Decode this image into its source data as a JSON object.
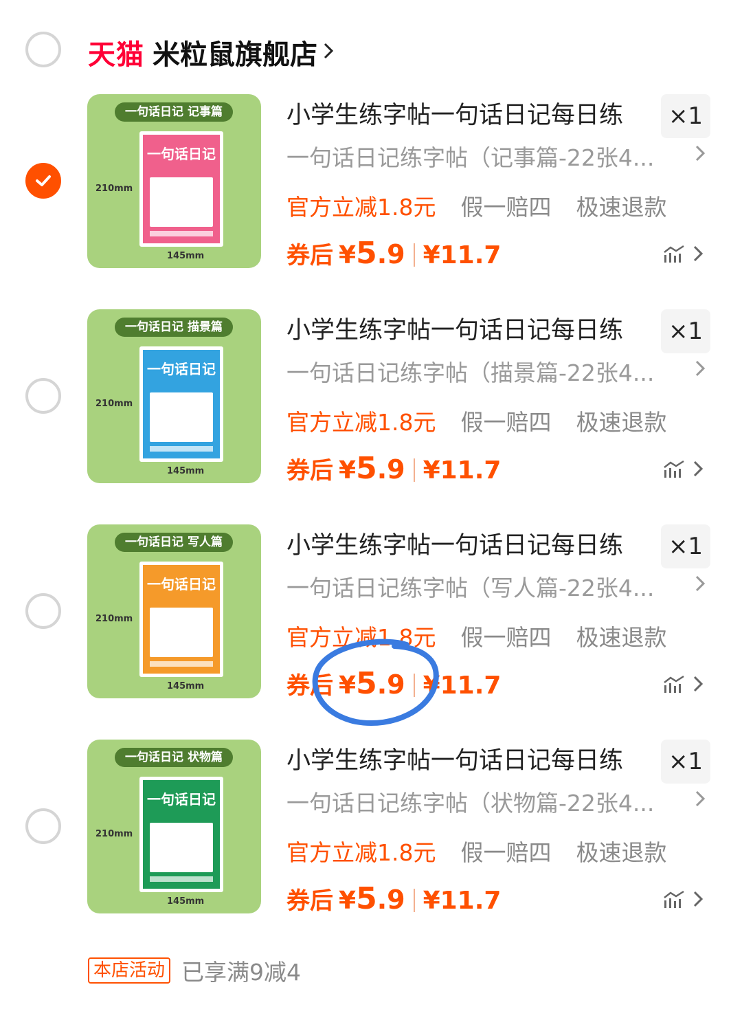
{
  "store": {
    "brand": "天猫",
    "name": "米粒鼠旗舰店"
  },
  "products": [
    {
      "thumb_tag": "一句话日记 记事篇",
      "book_title": "一句话日记",
      "book_color": "#f0608c",
      "dim_height": "210mm",
      "dim_width": "145mm",
      "title": "小学生练字帖一句话日记每日练",
      "qty": "×1",
      "sku": "一句话日记练字帖（记事篇-22张4...",
      "tag_discount": "官方立减1.8元",
      "tag_fake": "假一赔四",
      "tag_refund": "极速退款",
      "coupon_label": "券后",
      "price_yen": "¥",
      "price_int": "5",
      "price_dec": ".9",
      "price_orig": "¥11.7",
      "checked": true
    },
    {
      "thumb_tag": "一句话日记 描景篇",
      "book_title": "一句话日记",
      "book_color": "#33a3e0",
      "dim_height": "210mm",
      "dim_width": "145mm",
      "title": "小学生练字帖一句话日记每日练",
      "qty": "×1",
      "sku": "一句话日记练字帖（描景篇-22张4...",
      "tag_discount": "官方立减1.8元",
      "tag_fake": "假一赔四",
      "tag_refund": "极速退款",
      "coupon_label": "券后",
      "price_yen": "¥",
      "price_int": "5",
      "price_dec": ".9",
      "price_orig": "¥11.7",
      "checked": false
    },
    {
      "thumb_tag": "一句话日记 写人篇",
      "book_title": "一句话日记",
      "book_color": "#f59a2a",
      "dim_height": "210mm",
      "dim_width": "145mm",
      "title": "小学生练字帖一句话日记每日练",
      "qty": "×1",
      "sku": "一句话日记练字帖（写人篇-22张4...",
      "tag_discount": "官方立减1.8元",
      "tag_fake": "假一赔四",
      "tag_refund": "极速退款",
      "coupon_label": "券后",
      "price_yen": "¥",
      "price_int": "5",
      "price_dec": ".9",
      "price_orig": "¥11.7",
      "checked": false
    },
    {
      "thumb_tag": "一句话日记 状物篇",
      "book_title": "一句话日记",
      "book_color": "#1e9b57",
      "dim_height": "210mm",
      "dim_width": "145mm",
      "title": "小学生练字帖一句话日记每日练",
      "qty": "×1",
      "sku": "一句话日记练字帖（状物篇-22张4...",
      "tag_discount": "官方立减1.8元",
      "tag_fake": "假一赔四",
      "tag_refund": "极速退款",
      "coupon_label": "券后",
      "price_yen": "¥",
      "price_int": "5",
      "price_dec": ".9",
      "price_orig": "¥11.7",
      "checked": false
    }
  ],
  "promo": {
    "badge": "本店活动",
    "text": "已享满9减4"
  },
  "colors": {
    "accent": "#ff5000",
    "tmall": "#ff0036",
    "thumb_bg": "#a9d27e",
    "annotation": "#3a7be0"
  }
}
